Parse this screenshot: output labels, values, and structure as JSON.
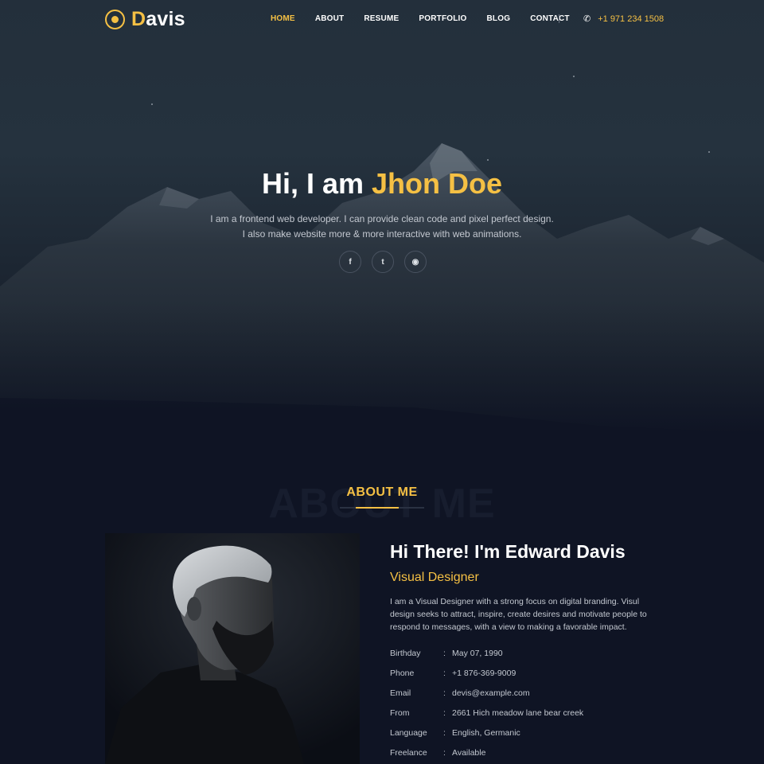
{
  "brand": {
    "first_letter": "D",
    "rest": "avis"
  },
  "nav": {
    "items": [
      {
        "label": "HOME",
        "active": true
      },
      {
        "label": "ABOUT",
        "active": false
      },
      {
        "label": "RESUME",
        "active": false
      },
      {
        "label": "PORTFOLIO",
        "active": false
      },
      {
        "label": "BLOG",
        "active": false
      },
      {
        "label": "CONTACT",
        "active": false
      }
    ],
    "phone": "+1 971 234 1508"
  },
  "hero": {
    "greeting": "Hi, I am ",
    "name": "Jhon Doe",
    "line1": "I am a frontend web developer. I can provide clean code and pixel perfect design.",
    "line2": "I also make website more & more interactive with web animations.",
    "socials": [
      {
        "icon": "facebook-icon",
        "glyph": "f"
      },
      {
        "icon": "twitter-icon",
        "glyph": "t"
      },
      {
        "icon": "github-icon",
        "glyph": "◉"
      }
    ]
  },
  "about": {
    "watermark": "ABOUT ME",
    "heading": "ABOUT ME",
    "intro": "Hi There! I'm Edward Davis",
    "role": "Visual Designer",
    "bio": "I am a Visual Designer with a strong focus on digital branding. Visul design seeks to attract, inspire, create desires and motivate people to respond to messages, with a view to making a favorable impact.",
    "details": [
      {
        "key": "Birthday",
        "value": "May 07, 1990"
      },
      {
        "key": "Phone",
        "value": "+1 876-369-9009"
      },
      {
        "key": "Email",
        "value": "devis@example.com"
      },
      {
        "key": "From",
        "value": "2661 Hich meadow lane bear creek"
      },
      {
        "key": "Language",
        "value": "English, Germanic"
      },
      {
        "key": "Freelance",
        "value": "Available"
      }
    ]
  },
  "colors": {
    "accent": "#f5c044",
    "background": "#0f1424"
  }
}
